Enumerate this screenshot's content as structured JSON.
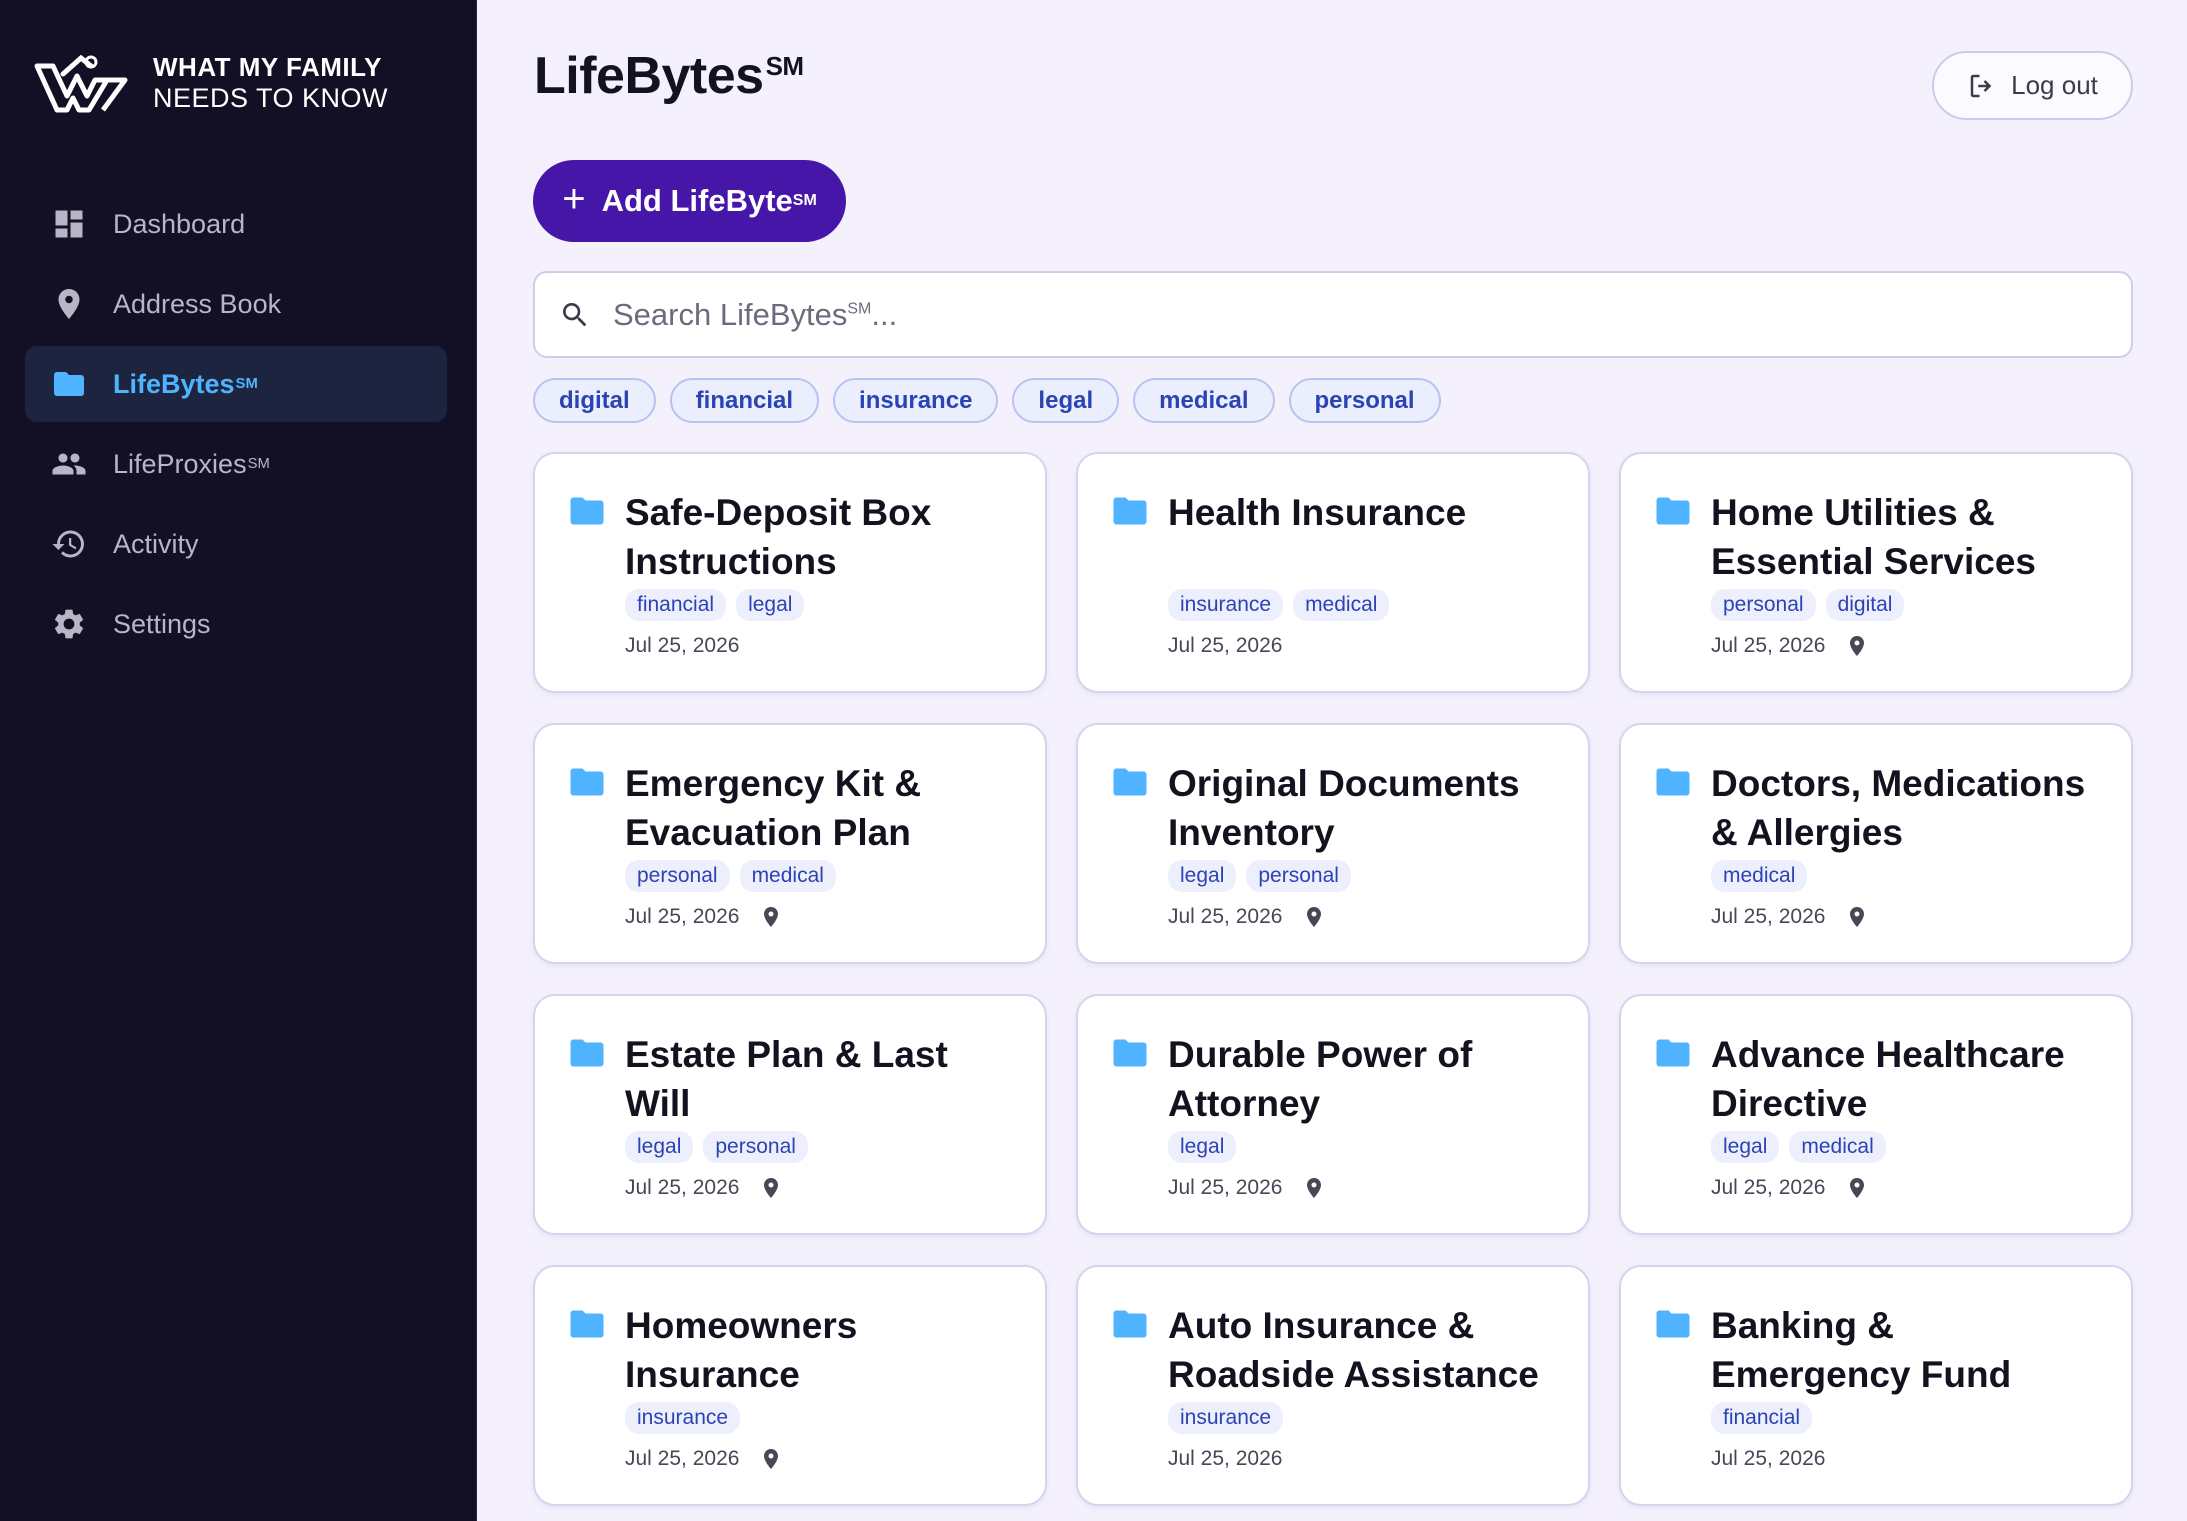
{
  "brand": {
    "line1": "WHAT MY FAMILY",
    "line2": "NEEDS TO KNOW"
  },
  "sidebar": {
    "items": [
      {
        "label": "Dashboard",
        "icon": "dashboard-icon",
        "active": false
      },
      {
        "label": "Address Book",
        "icon": "location-pin-icon",
        "active": false
      },
      {
        "label": "LifeBytes",
        "sup": "SM",
        "icon": "folder-icon",
        "active": true
      },
      {
        "label": "LifeProxies",
        "sup": "SM",
        "icon": "people-icon",
        "active": false
      },
      {
        "label": "Activity",
        "icon": "history-icon",
        "active": false
      },
      {
        "label": "Settings",
        "icon": "gear-icon",
        "active": false
      }
    ]
  },
  "header": {
    "title": "LifeBytes",
    "title_sup": "SM",
    "logout_label": "Log out",
    "add_label": "Add LifeByte",
    "add_sup": "SM"
  },
  "search": {
    "placeholder": "Search LifeBytes",
    "placeholder_sup": "SM",
    "placeholder_suffix": "..."
  },
  "filters": [
    "digital",
    "financial",
    "insurance",
    "legal",
    "medical",
    "personal"
  ],
  "cards": [
    {
      "title": "Safe-Deposit Box Instructions",
      "tags": [
        "financial",
        "legal"
      ],
      "date": "Jul 25, 2026",
      "location": false
    },
    {
      "title": "Health Insurance",
      "tags": [
        "insurance",
        "medical"
      ],
      "date": "Jul 25, 2026",
      "location": false
    },
    {
      "title": "Home Utilities & Essential Services",
      "tags": [
        "personal",
        "digital"
      ],
      "date": "Jul 25, 2026",
      "location": true
    },
    {
      "title": "Emergency Kit & Evacuation Plan",
      "tags": [
        "personal",
        "medical"
      ],
      "date": "Jul 25, 2026",
      "location": true
    },
    {
      "title": "Original Documents Inventory",
      "tags": [
        "legal",
        "personal"
      ],
      "date": "Jul 25, 2026",
      "location": true
    },
    {
      "title": "Doctors, Medications & Allergies",
      "tags": [
        "medical"
      ],
      "date": "Jul 25, 2026",
      "location": true
    },
    {
      "title": "Estate Plan & Last Will",
      "tags": [
        "legal",
        "personal"
      ],
      "date": "Jul 25, 2026",
      "location": true
    },
    {
      "title": "Durable Power of Attorney",
      "tags": [
        "legal"
      ],
      "date": "Jul 25, 2026",
      "location": true
    },
    {
      "title": "Advance Healthcare Directive",
      "tags": [
        "legal",
        "medical"
      ],
      "date": "Jul 25, 2026",
      "location": true
    },
    {
      "title": "Homeowners Insurance",
      "tags": [
        "insurance"
      ],
      "date": "Jul 25, 2026",
      "location": true
    },
    {
      "title": "Auto Insurance & Roadside Assistance",
      "tags": [
        "insurance"
      ],
      "date": "Jul 25, 2026",
      "location": false
    },
    {
      "title": "Banking & Emergency Fund",
      "tags": [
        "financial"
      ],
      "date": "Jul 25, 2026",
      "location": false
    }
  ],
  "colors": {
    "accent": "#4516a8",
    "active_nav": "#4fb3ff",
    "sidebar_bg": "#130f24",
    "page_bg": "#f4f1fc",
    "tag_text": "#2b43b5"
  }
}
